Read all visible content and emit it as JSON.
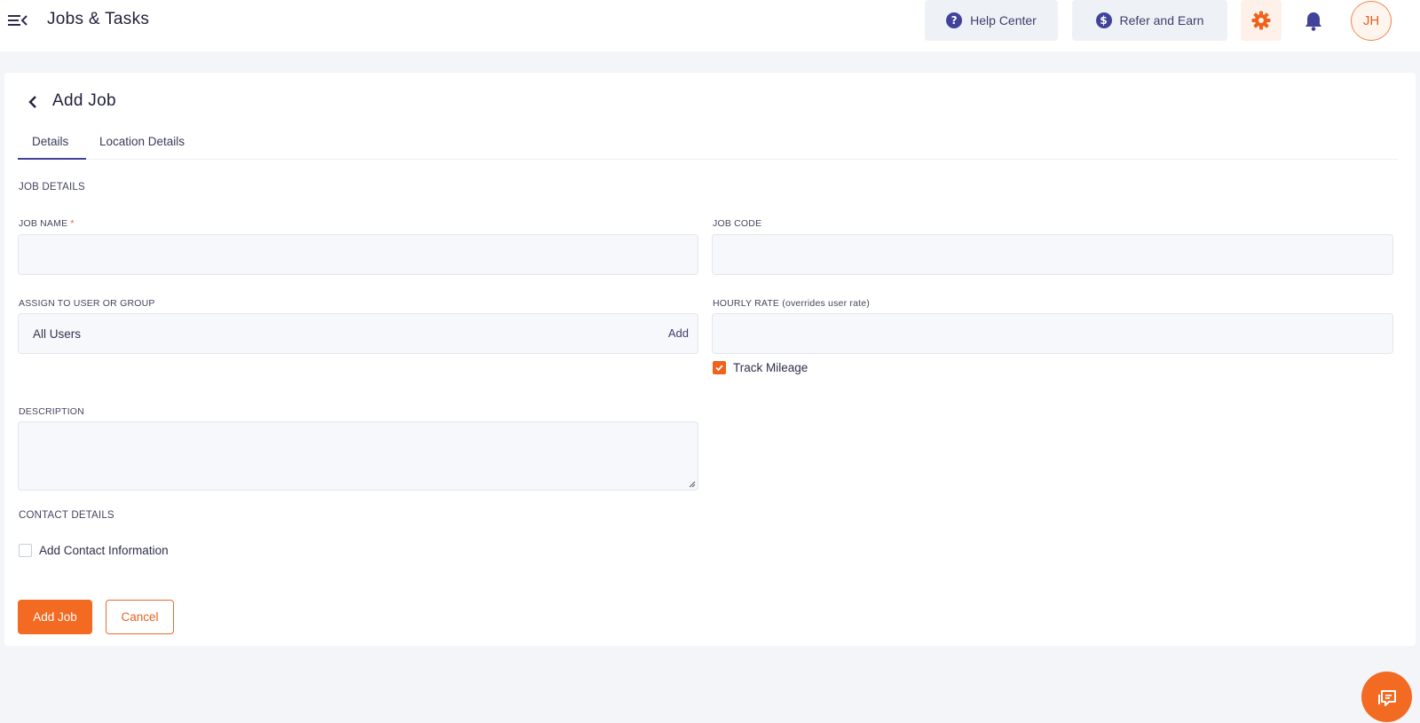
{
  "header": {
    "app_title": "Jobs & Tasks",
    "help_label": "Help Center",
    "refer_label": "Refer and Earn",
    "avatar_initials": "JH",
    "menu_icon": "menu-collapse-icon",
    "help_icon": "question-circle-icon",
    "refer_icon": "dollar-circle-icon",
    "settings_icon": "gear-icon",
    "notifications_icon": "bell-icon"
  },
  "page": {
    "title": "Add Job",
    "tabs": [
      {
        "label": "Details",
        "active": true
      },
      {
        "label": "Location Details",
        "active": false
      }
    ]
  },
  "form": {
    "job_details_heading": "JOB DETAILS",
    "job_name_label": "JOB NAME",
    "required_marker": "*",
    "job_name_value": "",
    "job_code_label": "JOB CODE",
    "job_code_value": "",
    "assign_label": "ASSIGN TO USER OR GROUP",
    "assign_value": "All Users",
    "assign_add_label": "Add",
    "hourly_rate_label": "HOURLY RATE (overrides user rate)",
    "hourly_rate_value": "",
    "track_mileage_label": "Track Mileage",
    "track_mileage_checked": true,
    "description_label": "DESCRIPTION",
    "description_value": "",
    "contact_heading": "CONTACT DETAILS",
    "add_contact_label": "Add Contact Information",
    "add_contact_checked": false
  },
  "actions": {
    "add_job_label": "Add Job",
    "cancel_label": "Cancel"
  },
  "colors": {
    "accent": "#f36a22",
    "brand_navy": "#41439b",
    "page_bg": "#f4f5f9"
  }
}
